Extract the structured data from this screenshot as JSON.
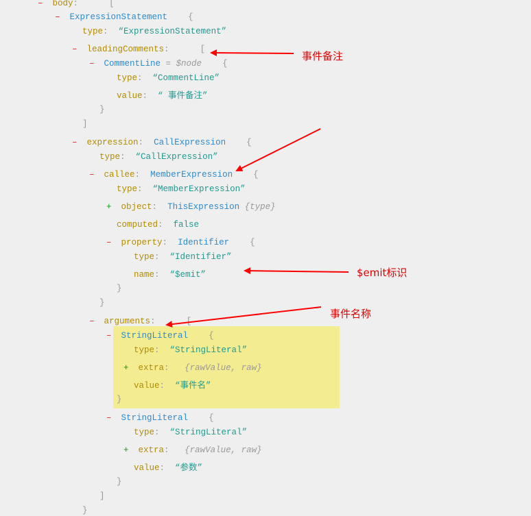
{
  "tree": [
    {
      "id": "body",
      "toggle": "-",
      "key": "body",
      "bracket": "["
    },
    {
      "id": "exprstmt",
      "toggle": "-",
      "type": "ExpressionStatement",
      "bracket": "{"
    },
    {
      "id": "exprstmt-type",
      "key": "type",
      "str": "“ExpressionStatement”"
    },
    {
      "id": "leading",
      "toggle": "-",
      "key": "leadingComments",
      "bracket": "["
    },
    {
      "id": "commentline",
      "toggle": "-",
      "type": "CommentLine",
      "meta": "= $node",
      "bracket": "{"
    },
    {
      "id": "commentline-type",
      "key": "type",
      "str": "“CommentLine”"
    },
    {
      "id": "commentline-value",
      "key": "value",
      "str": "“ 事件备注”"
    },
    {
      "id": "commentline-close",
      "bracket": "}"
    },
    {
      "id": "leading-close",
      "bracket": "]"
    },
    {
      "id": "expression",
      "toggle": "-",
      "key": "expression",
      "type": "CallExpression",
      "bracket": "{"
    },
    {
      "id": "expression-type",
      "key": "type",
      "str": "“CallExpression”"
    },
    {
      "id": "callee",
      "toggle": "-",
      "key": "callee",
      "type": "MemberExpression",
      "bracket": "{"
    },
    {
      "id": "callee-type",
      "key": "type",
      "str": "“MemberExpression”"
    },
    {
      "id": "object",
      "toggle": "+",
      "key": "object",
      "type": "ThisExpression",
      "meta": "{type}"
    },
    {
      "id": "computed",
      "key": "computed",
      "bool": "false"
    },
    {
      "id": "property",
      "toggle": "-",
      "key": "property",
      "type": "Identifier",
      "bracket": "{"
    },
    {
      "id": "property-type",
      "key": "type",
      "str": "“Identifier”"
    },
    {
      "id": "property-name",
      "key": "name",
      "str": "“$emit”"
    },
    {
      "id": "property-close",
      "bracket": "}"
    },
    {
      "id": "callee-close",
      "bracket": "}"
    },
    {
      "id": "arguments",
      "toggle": "-",
      "key": "arguments",
      "bracket": "["
    },
    {
      "id": "arg1",
      "toggle": "-",
      "type": "StringLiteral",
      "bracket": "{"
    },
    {
      "id": "arg1-type",
      "key": "type",
      "str": "“StringLiteral”"
    },
    {
      "id": "arg1-extra",
      "toggle": "+",
      "key": "extra",
      "meta": "{rawValue, raw}"
    },
    {
      "id": "arg1-value",
      "key": "value",
      "str": "“事件名”"
    },
    {
      "id": "arg1-close",
      "bracket": "}"
    },
    {
      "id": "arg2",
      "toggle": "-",
      "type": "StringLiteral",
      "bracket": "{"
    },
    {
      "id": "arg2-type",
      "key": "type",
      "str": "“StringLiteral”"
    },
    {
      "id": "arg2-extra",
      "toggle": "+",
      "key": "extra",
      "meta": "{rawValue, raw}"
    },
    {
      "id": "arg2-value",
      "key": "value",
      "str": "“参数”"
    },
    {
      "id": "arg2-close",
      "bracket": "}"
    },
    {
      "id": "arguments-close",
      "bracket": "]"
    },
    {
      "id": "expression-close",
      "bracket": "}"
    }
  ],
  "annotations": {
    "comment": "事件备注",
    "emit": "$emit标识",
    "event_name": "事件名称"
  },
  "colors": {
    "annotation": "#e00000",
    "highlight": "#f4ec90",
    "key": "#b38b00",
    "type": "#2d8acd",
    "string": "#22998f"
  }
}
